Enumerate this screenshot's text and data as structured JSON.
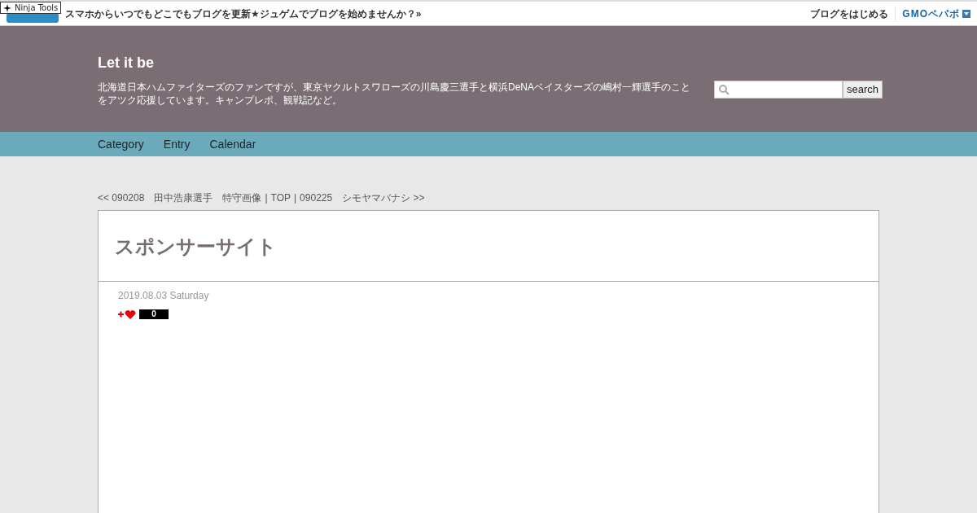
{
  "ninja_badge": {
    "label": "Ninja Tools"
  },
  "topbar": {
    "tagline": "スマホからいつでもどこでもブログを更新★ジュゲムでブログを始めませんか？»",
    "start_link": "ブログをはじめる",
    "company": "GMOペパボ"
  },
  "header": {
    "title": "Let it be",
    "description": "北海道日本ハムファイターズのファンですが、東京ヤクルトスワローズの川島慶三選手と横浜DeNAベイスターズの嶋村一輝選手のことをアツク応援しています。キャンプレポ、観戦記など。",
    "search_button": "search"
  },
  "nav": [
    {
      "label": "Category"
    },
    {
      "label": "Entry"
    },
    {
      "label": "Calendar"
    }
  ],
  "pager": {
    "prev": "<< 090208　田中浩康選手　特守画像",
    "separator_1": "|",
    "top": "TOP",
    "separator_2": "|",
    "next": "090225　シモヤマバナシ >>"
  },
  "entry": {
    "title": "スポンサーサイト",
    "date": "2019.08.03 Saturday",
    "like_count": "0"
  }
}
